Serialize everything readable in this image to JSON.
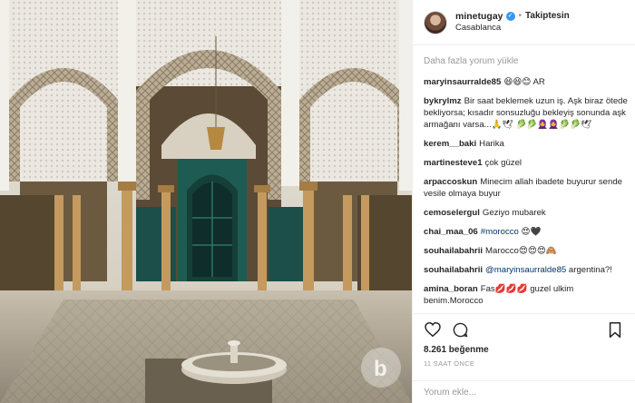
{
  "post": {
    "username": "minetugay",
    "separator": "•",
    "follow_label": "Takiptesin",
    "location": "Casablanca",
    "watermark": "b"
  },
  "comments_panel": {
    "load_more": "Daha fazla yorum yükle",
    "comments": [
      {
        "user": "maryinsaurralde85",
        "text": "😆😆😊 AR",
        "mention": ""
      },
      {
        "user": "bykrylmz",
        "text": "Bir saat beklemek uzun iş. Aşk biraz ötede bekliyorsa; kısadır sonsuzluğu bekleyiş sonunda aşk armağanı varsa...🙏🕊 🥬🥬🧕🧕🥬🥬🕊",
        "mention": ""
      },
      {
        "user": "kerem__baki",
        "text": "Harika",
        "mention": ""
      },
      {
        "user": "martinesteve1",
        "text": "çok güzel",
        "mention": ""
      },
      {
        "user": "arpaccoskun",
        "text": "Minecim allah ibadete buyurur sende vesile olmaya buyur",
        "mention": ""
      },
      {
        "user": "cemoselergul",
        "text": "Geziyo mubarek",
        "mention": ""
      },
      {
        "user": "chai_maa_06",
        "text": "😍🖤",
        "mention": "#morocco"
      },
      {
        "user": "souhailabahrii",
        "text": "Marocco😍😍😍🙈",
        "mention": ""
      },
      {
        "user": "souhailabahrii",
        "text": "argentina?!",
        "mention": "@maryinsaurralde85"
      },
      {
        "user": "amina_boran",
        "text": "Fas💋💋💋 guzel ulkim benim.Morocco",
        "mention": ""
      }
    ]
  },
  "actions": {
    "like_icon": "heart-icon",
    "comment_icon": "comment-icon",
    "save_icon": "bookmark-icon"
  },
  "likes_text": "8.261 beğenme",
  "time_text": "11 SAAT ÖNCE",
  "add_comment": {
    "placeholder": "Yorum ekle..."
  }
}
